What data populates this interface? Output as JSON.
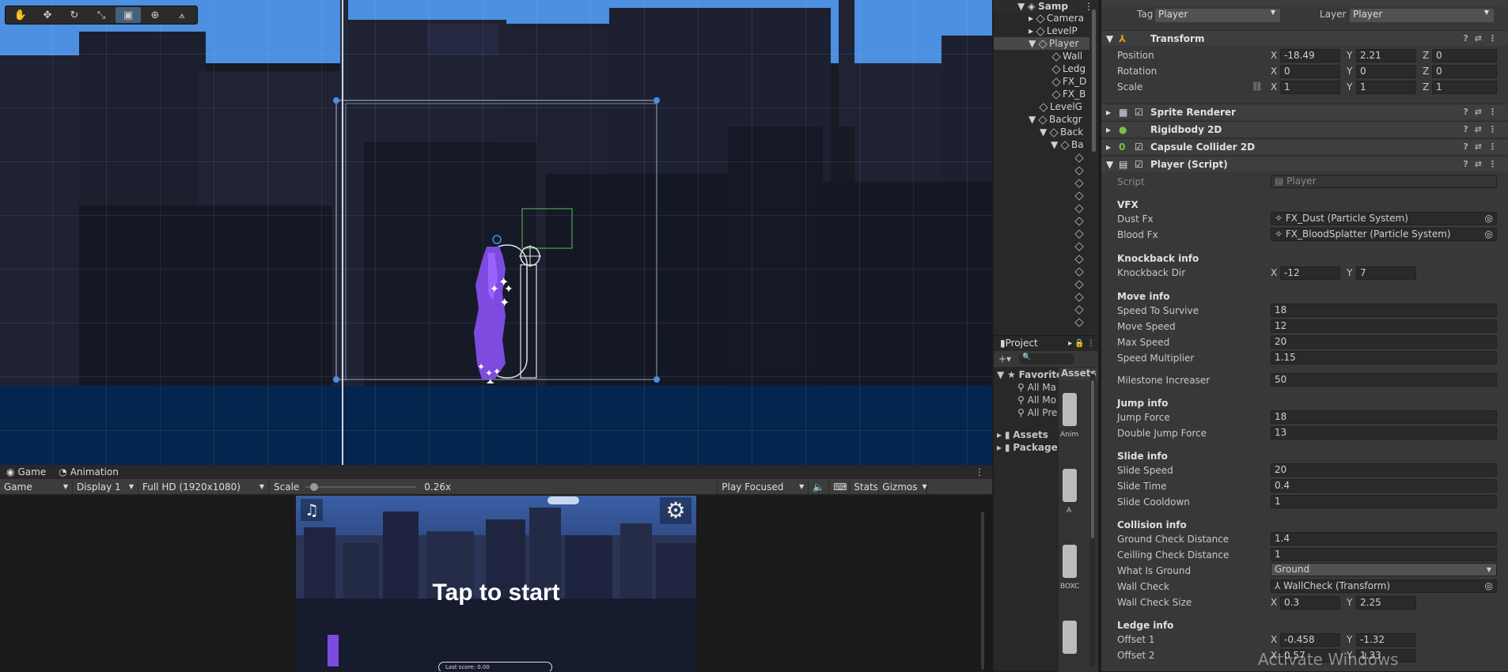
{
  "scene": {
    "tools": [
      "hand-tool",
      "move-tool",
      "rotate-tool",
      "scale-tool",
      "rect-tool",
      "transform-tool",
      "custom-tool"
    ]
  },
  "game_tabs": {
    "game": "Game",
    "animation": "Animation"
  },
  "game_controls": {
    "mode": "Game",
    "display": "Display 1",
    "resolution": "Full HD (1920x1080)",
    "scale_label": "Scale",
    "scale_value": "0.26x",
    "play_focused": "Play Focused",
    "stats": "Stats",
    "gizmos": "Gizmos"
  },
  "game_view": {
    "tap_text": "Tap to start",
    "small_text": "Last score: 0.00"
  },
  "hierarchy": {
    "items": [
      "Samp",
      "Camera",
      "LevelP",
      "Player",
      "Wall",
      "Ledg",
      "FX_D",
      "FX_B",
      "LevelG",
      "Backgr",
      "Back",
      "Ba"
    ]
  },
  "project": {
    "tab": "Project",
    "favorites": "Favorite",
    "fav_items": [
      "All Ma",
      "All Mo",
      "All Pre"
    ],
    "assets": "Assets",
    "packages": "Package",
    "assets_header": "Assets",
    "thumbs": [
      "Anim",
      "A",
      "BOXC"
    ]
  },
  "inspector": {
    "tag_label": "Tag",
    "tag_value": "Player",
    "layer_label": "Layer",
    "layer_value": "Player",
    "transform": {
      "title": "Transform",
      "position": {
        "label": "Position",
        "x": "-18.49",
        "y": "2.21",
        "z": "0"
      },
      "rotation": {
        "label": "Rotation",
        "x": "0",
        "y": "0",
        "z": "0"
      },
      "scale": {
        "label": "Scale",
        "x": "1",
        "y": "1",
        "z": "1"
      }
    },
    "components": [
      "Sprite Renderer",
      "Rigidbody 2D",
      "Capsule Collider 2D",
      "Player (Script)"
    ],
    "script_label": "Script",
    "script_value": "Player",
    "vfx": {
      "section": "VFX",
      "dust_label": "Dust Fx",
      "dust_value": "FX_Dust (Particle System)",
      "blood_label": "Blood Fx",
      "blood_value": "FX_BloodSplatter (Particle System)"
    },
    "knockback": {
      "section": "Knockback info",
      "label": "Knockback Dir",
      "x": "-12",
      "y": "7"
    },
    "move": {
      "section": "Move info",
      "rows": [
        {
          "label": "Speed To Survive",
          "value": "18"
        },
        {
          "label": "Move Speed",
          "value": "12"
        },
        {
          "label": "Max Speed",
          "value": "20"
        },
        {
          "label": "Speed Multiplier",
          "value": "1.15"
        },
        {
          "label": "Milestone Increaser",
          "value": "50"
        }
      ]
    },
    "jump": {
      "section": "Jump info",
      "rows": [
        {
          "label": "Jump Force",
          "value": "18"
        },
        {
          "label": "Double Jump Force",
          "value": "13"
        }
      ]
    },
    "slide": {
      "section": "Slide info",
      "rows": [
        {
          "label": "Slide Speed",
          "value": "20"
        },
        {
          "label": "Slide Time",
          "value": "0.4"
        },
        {
          "label": "Slide Cooldown",
          "value": "1"
        }
      ]
    },
    "collision": {
      "section": "Collision info",
      "ground_label": "Ground Check Distance",
      "ground_value": "1.4",
      "ceiling_label": "Ceilling Check Distance",
      "ceiling_value": "1",
      "what_label": "What Is Ground",
      "what_value": "Ground",
      "wall_label": "Wall Check",
      "wall_value": "WallCheck (Transform)",
      "size_label": "Wall Check Size",
      "size_x": "0.3",
      "size_y": "2.25"
    },
    "ledge": {
      "section": "Ledge info",
      "offset1_label": "Offset 1",
      "offset1_x": "-0.458",
      "offset1_y": "-1.32",
      "offset2_label": "Offset 2",
      "offset2_x": "0.57",
      "offset2_y": "1.33"
    }
  },
  "watermark": "Activate Windows"
}
